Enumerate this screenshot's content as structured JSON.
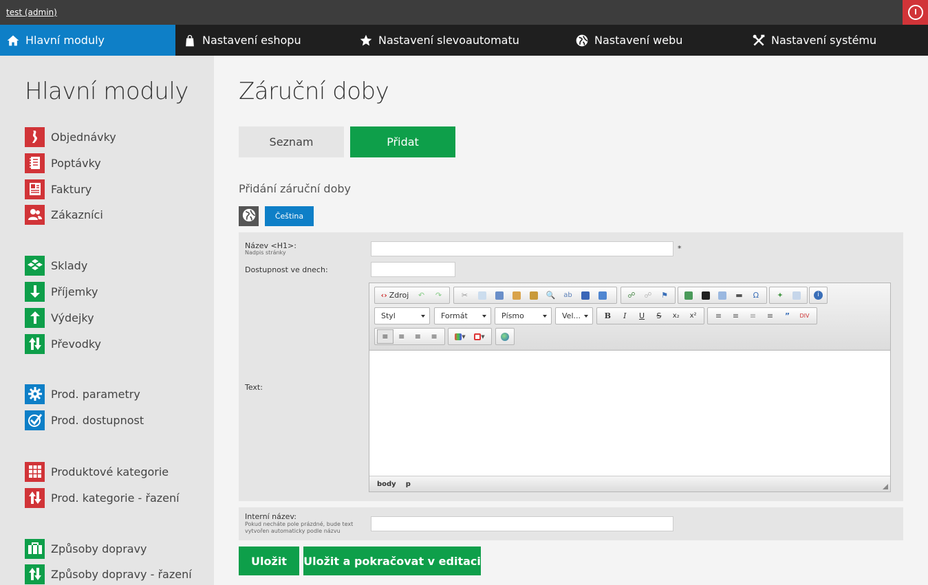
{
  "topbar": {
    "user": "test (admin)"
  },
  "nav": {
    "items": [
      {
        "label": "Hlavní moduly",
        "icon": "home-icon"
      },
      {
        "label": "Nastavení eshopu",
        "icon": "shopping-bag-icon"
      },
      {
        "label": "Nastavení slevoautomatu",
        "icon": "star-icon"
      },
      {
        "label": "Nastavení webu",
        "icon": "globe-icon"
      },
      {
        "label": "Nastavení systému",
        "icon": "tools-icon"
      }
    ]
  },
  "sidebar": {
    "title": "Hlavní moduly",
    "items": [
      {
        "label": "Objednávky",
        "icon": "orders-icon",
        "color": "#d13438"
      },
      {
        "label": "Poptávky",
        "icon": "notebook-icon",
        "color": "#d13438"
      },
      {
        "label": "Faktury",
        "icon": "invoice-icon",
        "color": "#d13438"
      },
      {
        "label": "Zákazníci",
        "icon": "users-icon",
        "color": "#d13438"
      },
      {
        "label": "Sklady",
        "icon": "warehouse-icon",
        "color": "#0e9f4a"
      },
      {
        "label": "Příjemky",
        "icon": "arrow-down-icon",
        "color": "#0e9f4a"
      },
      {
        "label": "Výdejky",
        "icon": "arrow-up-icon",
        "color": "#0e9f4a"
      },
      {
        "label": "Převodky",
        "icon": "transfer-icon",
        "color": "#0e9f4a"
      },
      {
        "label": "Prod. parametry",
        "icon": "gear-icon",
        "color": "#0e7fc7"
      },
      {
        "label": "Prod. dostupnost",
        "icon": "check-icon",
        "color": "#0e7fc7"
      },
      {
        "label": "Produktové kategorie",
        "icon": "grid-icon",
        "color": "#d13438"
      },
      {
        "label": "Prod. kategorie - řazení",
        "icon": "sort-icon",
        "color": "#d13438"
      },
      {
        "label": "Způsoby dopravy",
        "icon": "briefcase-icon",
        "color": "#0e9f4a"
      },
      {
        "label": "Způsoby dopravy - řazení",
        "icon": "sort-icon",
        "color": "#0e9f4a"
      }
    ]
  },
  "main": {
    "title": "Záruční doby",
    "tabs": {
      "list": "Seznam",
      "add": "Přidat"
    },
    "section_title": "Přidání záruční doby",
    "language": "Čeština",
    "form": {
      "name_label": "Název <H1>:",
      "name_sub": "Nadpis stránky",
      "name_value": "",
      "required_mark": "*",
      "days_label": "Dostupnost ve dnech:",
      "days_value": "",
      "text_label": "Text:",
      "internal_label": "Interní název:",
      "internal_sub": "Pokud necháte pole prázdné, bude text vytvořen automaticky podle názvu",
      "internal_value": ""
    },
    "editor": {
      "source_label": "Zdroj",
      "style_combo": "Styl",
      "format_combo": "Formát",
      "font_combo": "Písmo",
      "size_combo": "Vel...",
      "path": [
        "body",
        "p"
      ]
    },
    "buttons": {
      "save": "Uložit",
      "save_continue": "Uložit a pokračovat v editaci"
    }
  }
}
